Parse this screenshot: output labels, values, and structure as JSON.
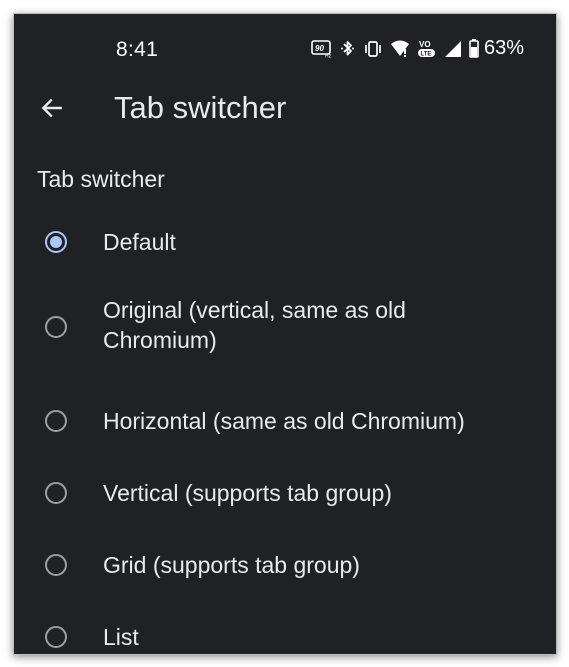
{
  "status_bar": {
    "time": "8:41",
    "battery_percent": "63%",
    "icons": [
      "refresh-rate-90hz-icon",
      "bluetooth-icon",
      "vibrate-icon",
      "wifi-icon",
      "volte-icon",
      "cell-signal-icon",
      "battery-icon"
    ],
    "icon_text": {
      "refresh_rate": "90",
      "volte": "VO",
      "lte": "LTE"
    }
  },
  "toolbar": {
    "back_icon": "arrow-back-icon",
    "title": "Tab switcher"
  },
  "section": {
    "header": "Tab switcher"
  },
  "options": [
    {
      "label": "Default",
      "selected": true
    },
    {
      "label": "Original (vertical, same as old Chromium)",
      "selected": false
    },
    {
      "label": "Horizontal (same as old Chromium)",
      "selected": false
    },
    {
      "label": "Vertical (supports tab group)",
      "selected": false
    },
    {
      "label": "Grid (supports tab group)",
      "selected": false
    },
    {
      "label": "List",
      "selected": false
    }
  ],
  "colors": {
    "background": "#202124",
    "text": "#e8eaed",
    "accent": "#a8c7fa",
    "radio_unselected": "#9aa0a6"
  }
}
